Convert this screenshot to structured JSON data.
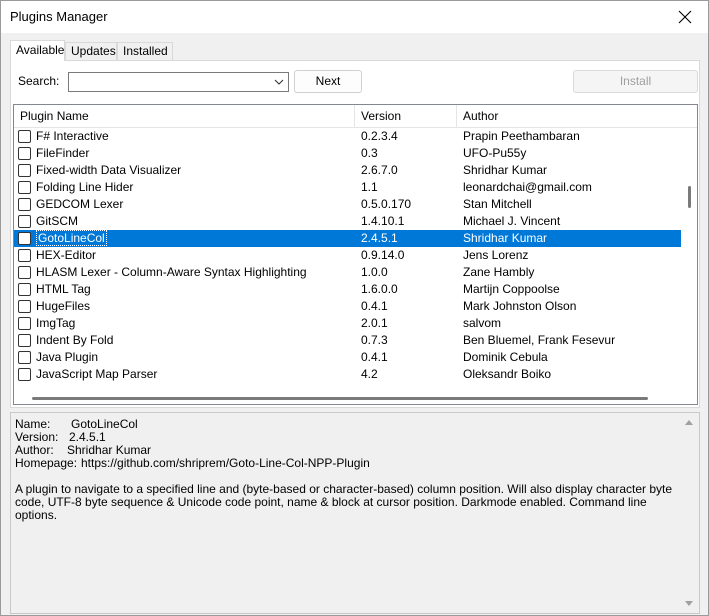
{
  "window": {
    "title": "Plugins Manager"
  },
  "tabs": [
    {
      "label": "Available"
    },
    {
      "label": "Updates"
    },
    {
      "label": "Installed"
    }
  ],
  "search": {
    "label": "Search:",
    "value": "",
    "next_label": "Next",
    "install_label": "Install"
  },
  "table": {
    "columns": [
      "Plugin Name",
      "Version",
      "Author"
    ],
    "selected_index": 6,
    "rows": [
      {
        "name": "F# Interactive",
        "version": "0.2.3.4",
        "author": "Prapin Peethambaran"
      },
      {
        "name": "FileFinder",
        "version": "0.3",
        "author": "UFO-Pu55y"
      },
      {
        "name": "Fixed-width Data Visualizer",
        "version": "2.6.7.0",
        "author": "Shridhar Kumar"
      },
      {
        "name": "Folding Line Hider",
        "version": "1.1",
        "author": "leonardchai@gmail.com"
      },
      {
        "name": "GEDCOM Lexer",
        "version": "0.5.0.170",
        "author": "Stan Mitchell"
      },
      {
        "name": "GitSCM",
        "version": "1.4.10.1",
        "author": "Michael J. Vincent"
      },
      {
        "name": "GotoLineCol",
        "version": "2.4.5.1",
        "author": "Shridhar Kumar"
      },
      {
        "name": "HEX-Editor",
        "version": "0.9.14.0",
        "author": "Jens Lorenz"
      },
      {
        "name": "HLASM Lexer - Column-Aware Syntax Highlighting",
        "version": "1.0.0",
        "author": "Zane Hambly"
      },
      {
        "name": "HTML Tag",
        "version": "1.6.0.0",
        "author": "Martijn Coppoolse"
      },
      {
        "name": "HugeFiles",
        "version": "0.4.1",
        "author": "Mark Johnston Olson"
      },
      {
        "name": "ImgTag",
        "version": "2.0.1",
        "author": "salvom"
      },
      {
        "name": "Indent By Fold",
        "version": "0.7.3",
        "author": "Ben Bluemel, Frank Fesevur"
      },
      {
        "name": "Java Plugin",
        "version": "0.4.1",
        "author": "Dominik Cebula"
      },
      {
        "name": "JavaScript Map Parser",
        "version": "4.2",
        "author": "Oleksandr Boiko"
      }
    ]
  },
  "details": {
    "name_label": "Name:",
    "name_value": "GotoLineCol",
    "version_label": "Version:",
    "version_value": "2.4.5.1",
    "author_label": "Author:",
    "author_value": "Shridhar Kumar",
    "homepage_label": "Homepage:",
    "homepage_value": "https://github.com/shriprem/Goto-Line-Col-NPP-Plugin",
    "description": "A plugin to navigate to a specified line and (byte-based or character-based) column position. Will also display character byte code, UTF-8 byte sequence & Unicode code point, name & block at cursor position. Darkmode enabled. Command line options."
  },
  "icons": {
    "close": "close-icon",
    "combo_arrow": "chevron-down-icon",
    "scroll_up": "scroll-up-icon",
    "scroll_down": "scroll-down-icon"
  },
  "colors": {
    "selection": "#0078d7"
  }
}
